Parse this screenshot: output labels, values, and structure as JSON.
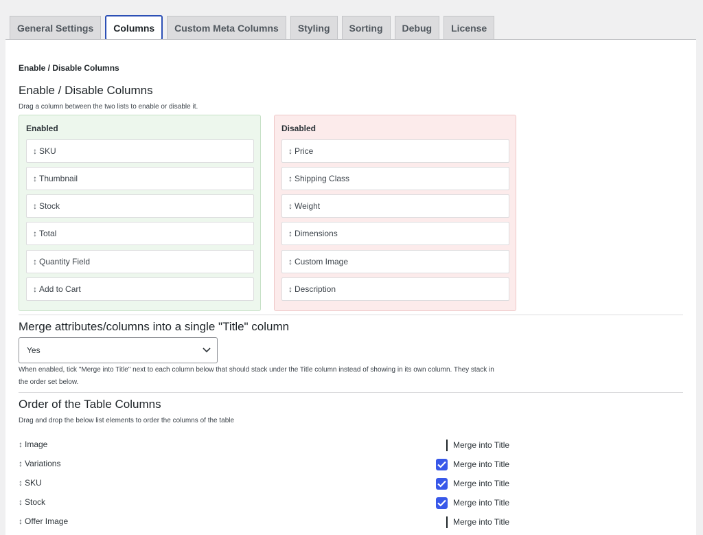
{
  "tabs": [
    {
      "label": "General Settings"
    },
    {
      "label": "Columns"
    },
    {
      "label": "Custom Meta Columns"
    },
    {
      "label": "Styling"
    },
    {
      "label": "Sorting"
    },
    {
      "label": "Debug"
    },
    {
      "label": "License"
    }
  ],
  "active_tab": "Columns",
  "page": {
    "small_heading": "Enable / Disable Columns",
    "section1_title": "Enable / Disable Columns",
    "section1_desc": "Drag a column between the two lists to enable or disable it."
  },
  "enabled": {
    "title": "Enabled",
    "items": [
      {
        "label": "SKU"
      },
      {
        "label": "Thumbnail"
      },
      {
        "label": "Stock"
      },
      {
        "label": "Total"
      },
      {
        "label": "Quantity Field"
      },
      {
        "label": "Add to Cart"
      }
    ]
  },
  "disabled": {
    "title": "Disabled",
    "items": [
      {
        "label": "Price"
      },
      {
        "label": "Shipping Class"
      },
      {
        "label": "Weight"
      },
      {
        "label": "Dimensions"
      },
      {
        "label": "Custom Image"
      },
      {
        "label": "Description"
      }
    ]
  },
  "merge": {
    "title": "Merge attributes/columns into a single \"Title\" column",
    "select_value": "Yes",
    "desc_line1": "When enabled, tick \"Merge into Title\" next to each column below that should stack under the Title column instead of showing in its own column. They stack in",
    "desc_line2": "the order set below."
  },
  "order": {
    "title": "Order of the Table Columns",
    "desc": "Drag and drop the below list elements to order the columns of the table",
    "merge_label": "Merge into Title",
    "rows": [
      {
        "label": "Image",
        "merged": false
      },
      {
        "label": "Variations",
        "merged": true
      },
      {
        "label": "SKU",
        "merged": true
      },
      {
        "label": "Stock",
        "merged": true
      },
      {
        "label": "Offer Image",
        "merged": false
      }
    ]
  },
  "icons": {
    "drag": "↕",
    "check": "check-icon",
    "chevron": "chevron-down-icon"
  },
  "colors": {
    "accent": "#3858e9",
    "active_tab_border": "#2c4fb5",
    "enabled_bg": "#edf7ed",
    "disabled_bg": "#fcebeb"
  }
}
